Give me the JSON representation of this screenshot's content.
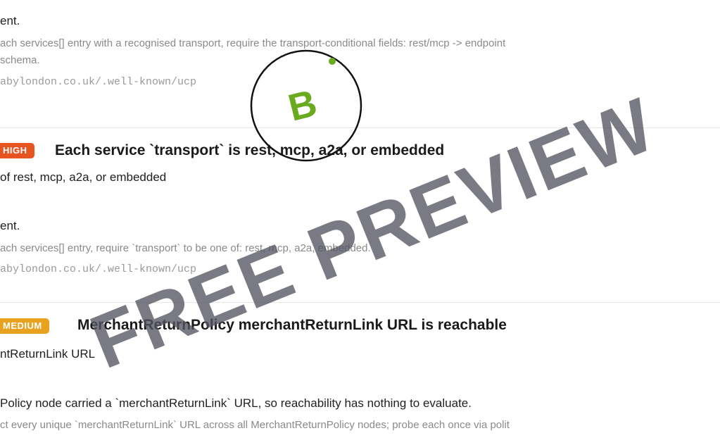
{
  "block1": {
    "line_result": "ent.",
    "line_desc_1": "ach services[] entry with a recognised transport, require the transport-conditional fields: rest/mcp -> endpoint",
    "line_desc_2": "schema.",
    "url": "abylondon.co.uk/.well-known/ucp"
  },
  "check2": {
    "severity": "HIGH",
    "title": "Each service `transport` is rest, mcp, a2a, or embedded",
    "subtitle": "of rest, mcp, a2a, or embedded",
    "result": "ent.",
    "desc": "ach services[] entry, require `transport` to be one of: rest, mcp, a2a, embedded.",
    "url": "abylondon.co.uk/.well-known/ucp"
  },
  "check3": {
    "severity": "MEDIUM",
    "title": "MerchantReturnPolicy merchantReturnLink URL is reachable",
    "subtitle": "ntReturnLink URL",
    "result": "Policy node carried a `merchantReturnLink` URL, so reachability has nothing to evaluate.",
    "desc": "ct every unique `merchantReturnLink` URL across all MerchantReturnPolicy nodes; probe each once via polit"
  },
  "grade": {
    "letter": "B"
  },
  "watermark": {
    "text": "FREE PREVIEW"
  },
  "colors": {
    "high": "#e8541f",
    "medium": "#e8a21f",
    "grade": "#6aaa1e",
    "watermark": "#555562"
  }
}
